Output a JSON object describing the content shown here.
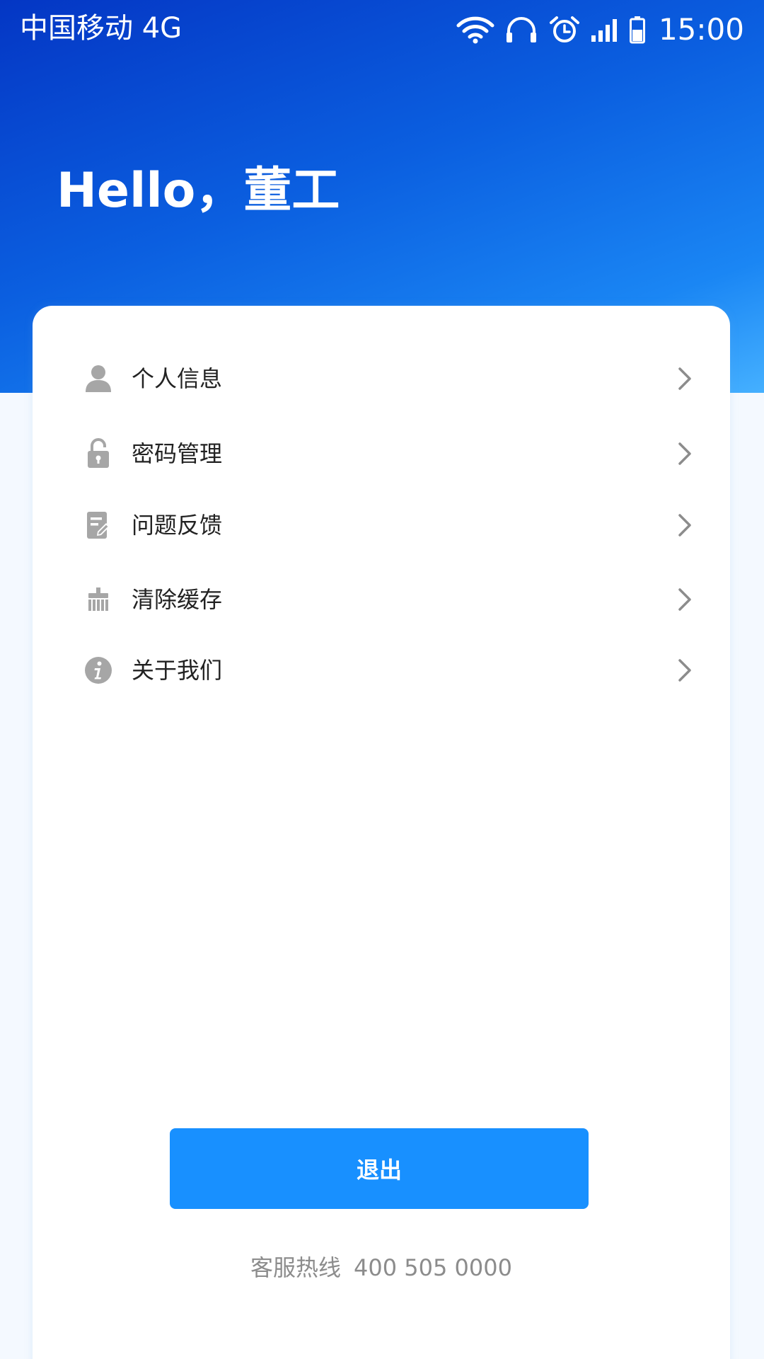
{
  "status_bar": {
    "carrier": "中国移动 4G",
    "time": "15:00",
    "icons": [
      "wifi-icon",
      "headphones-icon",
      "alarm-icon",
      "signal-icon",
      "battery-icon"
    ]
  },
  "header": {
    "greeting": "Hello，董工"
  },
  "menu": {
    "items": [
      {
        "label": "个人信息",
        "icon": "person-icon"
      },
      {
        "label": "密码管理",
        "icon": "lock-icon"
      },
      {
        "label": "问题反馈",
        "icon": "feedback-icon"
      },
      {
        "label": "清除缓存",
        "icon": "brush-icon"
      },
      {
        "label": "关于我们",
        "icon": "info-icon"
      }
    ]
  },
  "actions": {
    "logout_label": "退出"
  },
  "footer": {
    "hotline_label": "客服热线",
    "hotline_number": "400 505 0000"
  },
  "colors": {
    "header_gradient_start": "#0436c4",
    "header_gradient_end": "#45b0ff",
    "primary_button": "#1890ff",
    "icon_gray": "#a6a6a6",
    "text_dark": "#222222",
    "text_muted": "#8c8c8c"
  }
}
